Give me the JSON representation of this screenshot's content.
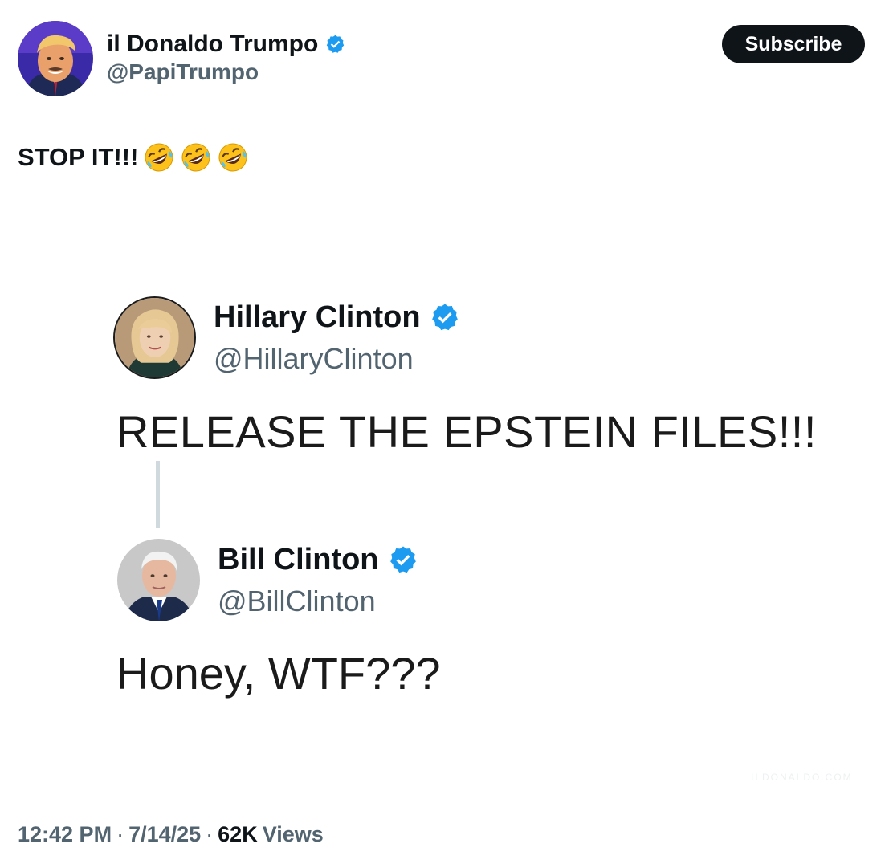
{
  "author": {
    "name": "il Donaldo Trumpo",
    "handle": "@PapiTrumpo",
    "verified": true
  },
  "subscribe_label": "Subscribe",
  "post": {
    "text": "STOP IT!!!",
    "emojis": [
      "rolling-on-floor-laughing",
      "rolling-on-floor-laughing",
      "rolling-on-floor-laughing"
    ]
  },
  "embedded_image": {
    "first_tweet": {
      "name": "Hillary Clinton",
      "handle": "@HillaryClinton",
      "verified": true,
      "text": "RELEASE THE EPSTEIN FILES!!!"
    },
    "reply_tweet": {
      "name": "Bill Clinton",
      "handle": "@BillClinton",
      "verified": true,
      "text": "Honey, WTF???"
    },
    "watermark": "ILDONALDO.COM"
  },
  "meta": {
    "time": "12:42 PM",
    "date": "7/14/25",
    "views_count": "62K",
    "views_label": "Views",
    "separator": "·"
  },
  "colors": {
    "verified_blue": "#1d9bf0",
    "text_primary": "#0f1419",
    "text_secondary": "#536471",
    "button_bg": "#0f1419",
    "thread_line": "#cfd9de"
  }
}
